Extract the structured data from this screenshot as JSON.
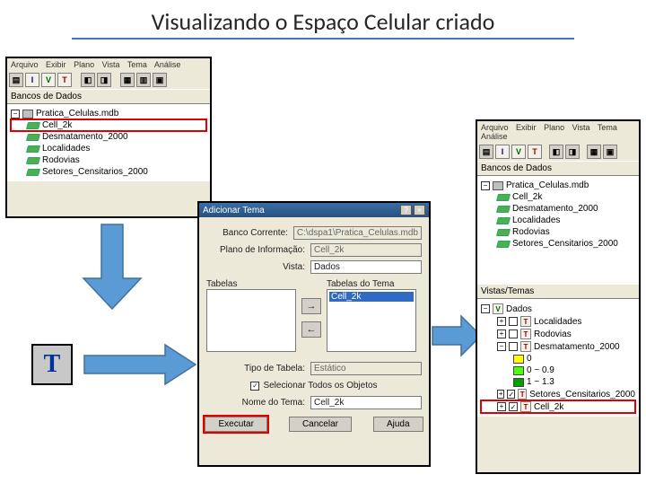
{
  "title": "Visualizando o Espaço Celular criado",
  "menu": {
    "arquivo": "Arquivo",
    "exibir": "Exibir",
    "plano": "Plano",
    "vista": "Vista",
    "tema": "Tema",
    "analise": "Análise"
  },
  "toolbar": {
    "i": "I",
    "v": "V",
    "t": "T"
  },
  "db_panel": {
    "label": "Bancos de Dados",
    "db": "Pratica_Celulas.mdb",
    "layers": [
      "Cell_2k",
      "Desmatamento_2000",
      "Localidades",
      "Rodovias",
      "Setores_Censitarios_2000"
    ]
  },
  "dialog": {
    "title": "Adicionar Tema",
    "banco_lbl": "Banco Corrente:",
    "banco": "C:\\dspa1\\Pratica_Celulas.mdb",
    "plano_lbl": "Plano de Informação:",
    "plano": "Cell_2k",
    "vista_lbl": "Vista:",
    "vista": "Dados",
    "tabelas_lbl": "Tabelas",
    "tabelas_tema_lbl": "Tabelas do Tema",
    "tema_item": "Cell_2k",
    "tipo_lbl": "Tipo de Tabela:",
    "tipo": "Estático",
    "sel_all": "Selecionar Todos os Objetos",
    "nome_lbl": "Nome do Tema:",
    "nome": "Cell_2k",
    "executar": "Executar",
    "cancelar": "Cancelar",
    "ajuda": "Ajuda"
  },
  "views_panel": {
    "label": "Vistas/Temas",
    "vista": "Dados",
    "themes": [
      "Localidades",
      "Rodovias",
      "Desmatamento_2000"
    ],
    "legend": [
      {
        "color": "#ffff00",
        "lbl": "0"
      },
      {
        "color": "#4cff00",
        "lbl": "0 ~ 0.9"
      },
      {
        "color": "#00a000",
        "lbl": "1 ~ 1.3"
      }
    ],
    "theme_sc": "Setores_Censitarios_2000",
    "theme_cell": "Cell_2k"
  },
  "t_icon": "T"
}
